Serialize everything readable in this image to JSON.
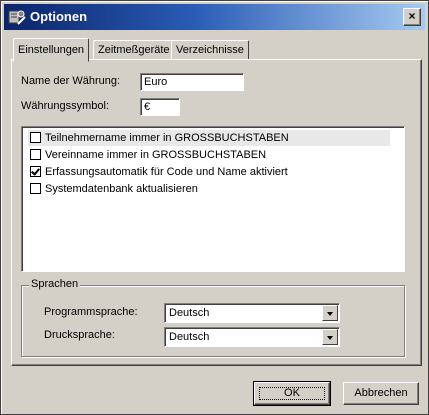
{
  "window": {
    "title": "Optionen",
    "close_label": "×"
  },
  "tabs": [
    {
      "label": "Einstellungen"
    },
    {
      "label": "Zeitmeßgeräte"
    },
    {
      "label": "Verzeichnisse"
    }
  ],
  "currency": {
    "name_label": "Name der Währung:",
    "name_value": "Euro",
    "symbol_label": "Währungssymbol:",
    "symbol_value": "€"
  },
  "options": [
    {
      "label": "Teilnehmername immer in GROSSBUCHSTABEN",
      "checked": false
    },
    {
      "label": "Vereinname immer in GROSSBUCHSTABEN",
      "checked": false
    },
    {
      "label": "Erfassungsautomatik für Code und Name aktiviert",
      "checked": true
    },
    {
      "label": "Systemdatenbank aktualisieren",
      "checked": false
    }
  ],
  "languages": {
    "group_title": "Sprachen",
    "program_label": "Programmsprache:",
    "program_value": "Deutsch",
    "print_label": "Drucksprache:",
    "print_value": "Deutsch"
  },
  "buttons": {
    "ok": "OK",
    "cancel": "Abbrechen"
  }
}
